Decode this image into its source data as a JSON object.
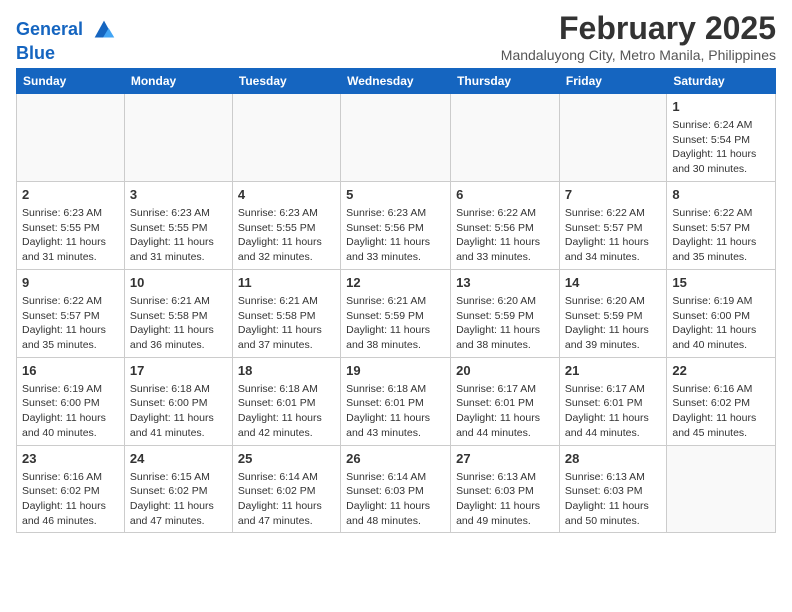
{
  "logo": {
    "line1": "General",
    "line2": "Blue"
  },
  "title": "February 2025",
  "subtitle": "Mandaluyong City, Metro Manila, Philippines",
  "weekdays": [
    "Sunday",
    "Monday",
    "Tuesday",
    "Wednesday",
    "Thursday",
    "Friday",
    "Saturday"
  ],
  "weeks": [
    [
      {
        "day": "",
        "info": ""
      },
      {
        "day": "",
        "info": ""
      },
      {
        "day": "",
        "info": ""
      },
      {
        "day": "",
        "info": ""
      },
      {
        "day": "",
        "info": ""
      },
      {
        "day": "",
        "info": ""
      },
      {
        "day": "1",
        "info": "Sunrise: 6:24 AM\nSunset: 5:54 PM\nDaylight: 11 hours\nand 30 minutes."
      }
    ],
    [
      {
        "day": "2",
        "info": "Sunrise: 6:23 AM\nSunset: 5:55 PM\nDaylight: 11 hours\nand 31 minutes."
      },
      {
        "day": "3",
        "info": "Sunrise: 6:23 AM\nSunset: 5:55 PM\nDaylight: 11 hours\nand 31 minutes."
      },
      {
        "day": "4",
        "info": "Sunrise: 6:23 AM\nSunset: 5:55 PM\nDaylight: 11 hours\nand 32 minutes."
      },
      {
        "day": "5",
        "info": "Sunrise: 6:23 AM\nSunset: 5:56 PM\nDaylight: 11 hours\nand 33 minutes."
      },
      {
        "day": "6",
        "info": "Sunrise: 6:22 AM\nSunset: 5:56 PM\nDaylight: 11 hours\nand 33 minutes."
      },
      {
        "day": "7",
        "info": "Sunrise: 6:22 AM\nSunset: 5:57 PM\nDaylight: 11 hours\nand 34 minutes."
      },
      {
        "day": "8",
        "info": "Sunrise: 6:22 AM\nSunset: 5:57 PM\nDaylight: 11 hours\nand 35 minutes."
      }
    ],
    [
      {
        "day": "9",
        "info": "Sunrise: 6:22 AM\nSunset: 5:57 PM\nDaylight: 11 hours\nand 35 minutes."
      },
      {
        "day": "10",
        "info": "Sunrise: 6:21 AM\nSunset: 5:58 PM\nDaylight: 11 hours\nand 36 minutes."
      },
      {
        "day": "11",
        "info": "Sunrise: 6:21 AM\nSunset: 5:58 PM\nDaylight: 11 hours\nand 37 minutes."
      },
      {
        "day": "12",
        "info": "Sunrise: 6:21 AM\nSunset: 5:59 PM\nDaylight: 11 hours\nand 38 minutes."
      },
      {
        "day": "13",
        "info": "Sunrise: 6:20 AM\nSunset: 5:59 PM\nDaylight: 11 hours\nand 38 minutes."
      },
      {
        "day": "14",
        "info": "Sunrise: 6:20 AM\nSunset: 5:59 PM\nDaylight: 11 hours\nand 39 minutes."
      },
      {
        "day": "15",
        "info": "Sunrise: 6:19 AM\nSunset: 6:00 PM\nDaylight: 11 hours\nand 40 minutes."
      }
    ],
    [
      {
        "day": "16",
        "info": "Sunrise: 6:19 AM\nSunset: 6:00 PM\nDaylight: 11 hours\nand 40 minutes."
      },
      {
        "day": "17",
        "info": "Sunrise: 6:18 AM\nSunset: 6:00 PM\nDaylight: 11 hours\nand 41 minutes."
      },
      {
        "day": "18",
        "info": "Sunrise: 6:18 AM\nSunset: 6:01 PM\nDaylight: 11 hours\nand 42 minutes."
      },
      {
        "day": "19",
        "info": "Sunrise: 6:18 AM\nSunset: 6:01 PM\nDaylight: 11 hours\nand 43 minutes."
      },
      {
        "day": "20",
        "info": "Sunrise: 6:17 AM\nSunset: 6:01 PM\nDaylight: 11 hours\nand 44 minutes."
      },
      {
        "day": "21",
        "info": "Sunrise: 6:17 AM\nSunset: 6:01 PM\nDaylight: 11 hours\nand 44 minutes."
      },
      {
        "day": "22",
        "info": "Sunrise: 6:16 AM\nSunset: 6:02 PM\nDaylight: 11 hours\nand 45 minutes."
      }
    ],
    [
      {
        "day": "23",
        "info": "Sunrise: 6:16 AM\nSunset: 6:02 PM\nDaylight: 11 hours\nand 46 minutes."
      },
      {
        "day": "24",
        "info": "Sunrise: 6:15 AM\nSunset: 6:02 PM\nDaylight: 11 hours\nand 47 minutes."
      },
      {
        "day": "25",
        "info": "Sunrise: 6:14 AM\nSunset: 6:02 PM\nDaylight: 11 hours\nand 47 minutes."
      },
      {
        "day": "26",
        "info": "Sunrise: 6:14 AM\nSunset: 6:03 PM\nDaylight: 11 hours\nand 48 minutes."
      },
      {
        "day": "27",
        "info": "Sunrise: 6:13 AM\nSunset: 6:03 PM\nDaylight: 11 hours\nand 49 minutes."
      },
      {
        "day": "28",
        "info": "Sunrise: 6:13 AM\nSunset: 6:03 PM\nDaylight: 11 hours\nand 50 minutes."
      },
      {
        "day": "",
        "info": ""
      }
    ]
  ]
}
